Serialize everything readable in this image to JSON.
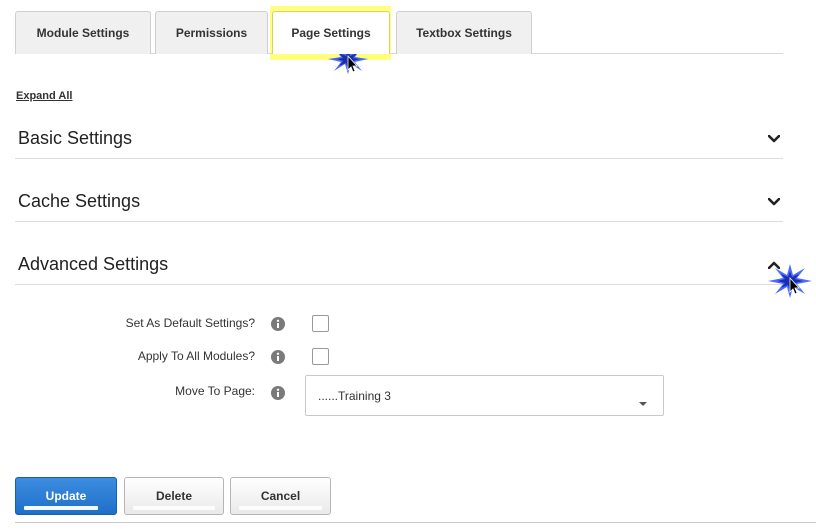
{
  "tabs": [
    {
      "label": "Module Settings"
    },
    {
      "label": "Permissions"
    },
    {
      "label": "Page Settings"
    },
    {
      "label": "Textbox Settings"
    }
  ],
  "active_tab": "Page Settings",
  "highlight_color": "#ffff66",
  "expand_all": "Expand All",
  "sections": [
    {
      "title": "Basic Settings",
      "state": "collapsed",
      "icon": "chevron-down-icon"
    },
    {
      "title": "Cache Settings",
      "state": "collapsed",
      "icon": "chevron-down-icon"
    },
    {
      "title": "Advanced Settings",
      "state": "expanded",
      "icon": "chevron-up-icon"
    }
  ],
  "advanced": {
    "set_default_label": "Set As Default Settings?",
    "set_default_checked": false,
    "apply_all_label": "Apply To All Modules?",
    "apply_all_checked": false,
    "move_to_page_label": "Move To Page:",
    "move_to_page_value": "......Training 3"
  },
  "buttons": {
    "update": "Update",
    "delete": "Delete",
    "cancel": "Cancel"
  },
  "colors": {
    "primary": "#1f6fc9",
    "burst": "#3355ff"
  }
}
